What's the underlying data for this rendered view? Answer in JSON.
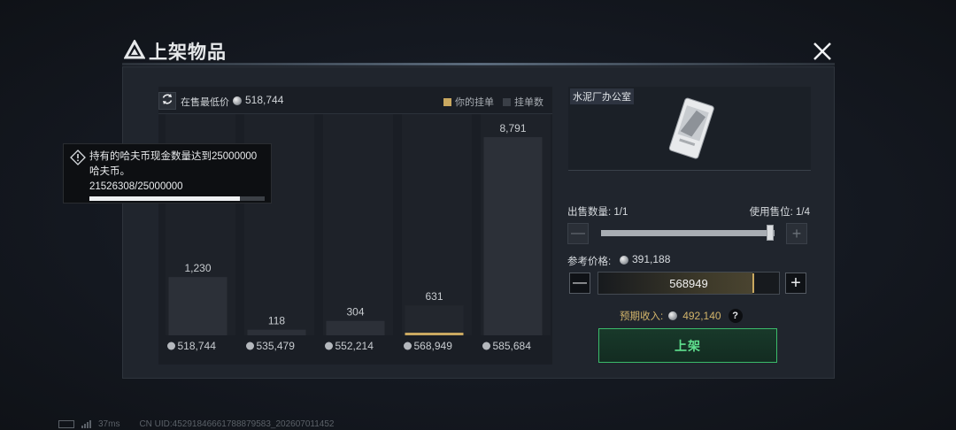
{
  "window": {
    "title": "上架物品"
  },
  "chart_header": {
    "lowest_label": "在售最低价",
    "lowest_value": "518,744",
    "legend_yours": "你的挂单",
    "legend_count": "挂单数"
  },
  "chart_data": {
    "type": "bar",
    "categories": [
      "518,744",
      "535,479",
      "552,214",
      "568,949",
      "585,684"
    ],
    "values": [
      1230,
      118,
      304,
      631,
      8791
    ],
    "value_labels": [
      "1,230",
      "118",
      "304",
      "631",
      "8,791"
    ],
    "highlight_index": 3,
    "colors": {
      "bar": "#2c3038",
      "highlight": "#c9a860",
      "column_bg": "#1e2229"
    }
  },
  "tooltip": {
    "line1": "持有的哈夫币现金数量达到25000000",
    "line2": "哈夫币。",
    "progress_text": "21526308/25000000",
    "progress_fraction": 0.861
  },
  "item": {
    "name": "水泥厂办公室"
  },
  "quantity": {
    "label": "出售数量: 1/1",
    "slots_label": "使用售位: 1/4",
    "fraction": 1.0
  },
  "reference_price": {
    "label": "参考价格:",
    "value": "391,188"
  },
  "price_input": {
    "value": "568949"
  },
  "income": {
    "label": "预期收入:",
    "value": "492,140"
  },
  "list_button": {
    "label": "上架"
  },
  "status_bar": {
    "ping": "37ms",
    "uid": "CN UID:45291846661788879583_202607011452"
  },
  "colors": {
    "accent_gold": "#d2b46a",
    "accent_green": "#5fe08e"
  }
}
